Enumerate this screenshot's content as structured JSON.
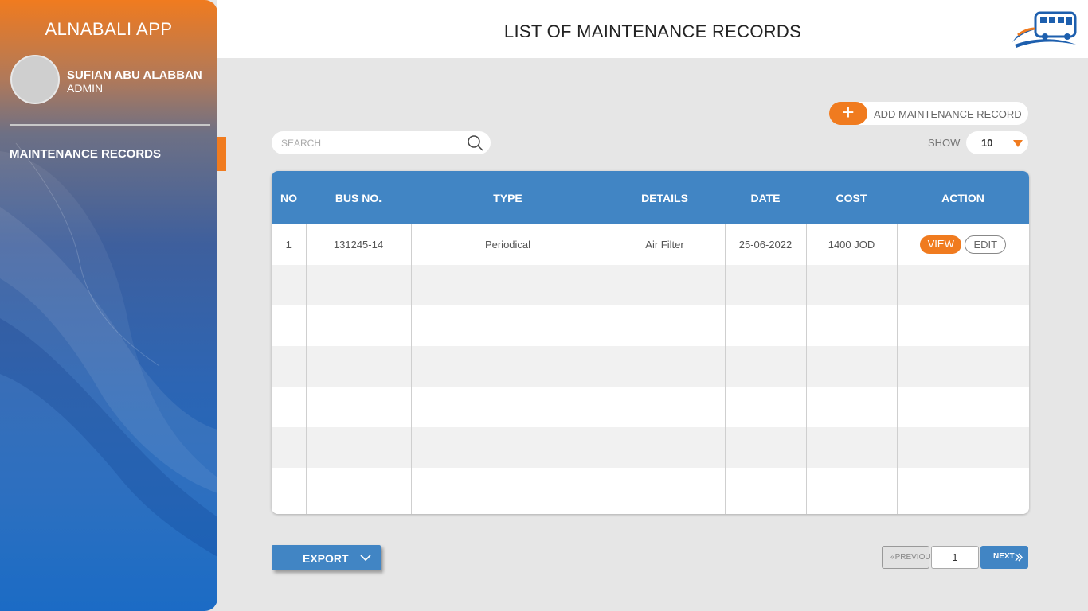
{
  "sidebar": {
    "app_title": "ALNABALI APP",
    "user_name": "SUFIAN ABU ALABBAN",
    "user_role": "ADMIN",
    "nav_items": [
      {
        "label": "MAINTENANCE RECORDS",
        "active": true
      }
    ]
  },
  "header": {
    "title": "LIST OF MAINTENANCE RECORDS"
  },
  "toolbar": {
    "add_label": "ADD MAINTENANCE RECORD",
    "search_placeholder": "SEARCH",
    "show_label": "SHOW",
    "show_value": "10"
  },
  "table": {
    "columns": [
      "NO",
      "BUS NO.",
      "TYPE",
      "DETAILS",
      "DATE",
      "COST",
      "ACTION"
    ],
    "rows": [
      {
        "no": "1",
        "bus_no": "131245-14",
        "type": "Periodical",
        "details": "Air Filter",
        "date": "25-06-2022",
        "cost": "1400 JOD"
      }
    ],
    "actions": {
      "view": "VIEW",
      "edit": "EDIT"
    }
  },
  "footer": {
    "export_label": "EXPORT",
    "prev_label": "PREVIOUS",
    "page": "1",
    "next_label": "NEXT"
  },
  "colors": {
    "accent": "#f07b1f",
    "primary": "#4185c4",
    "background": "#e6e6e6"
  }
}
